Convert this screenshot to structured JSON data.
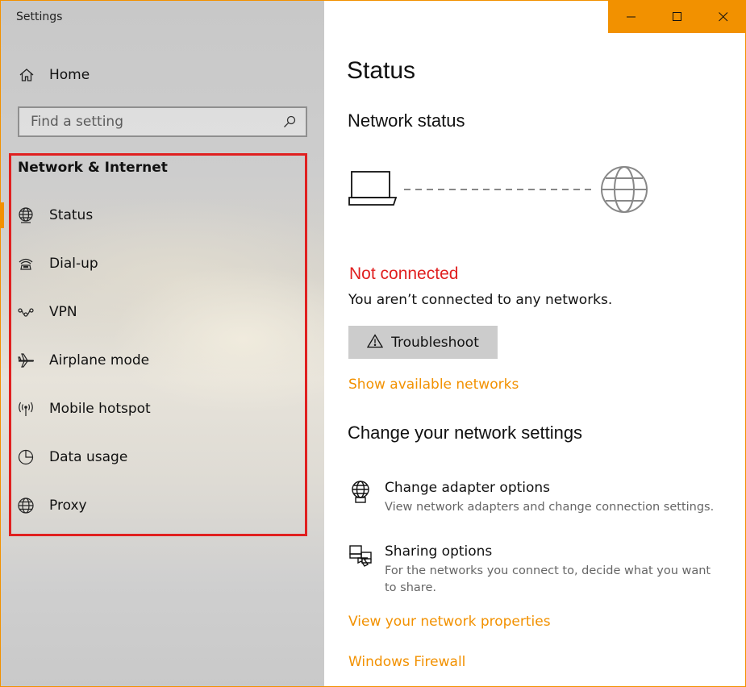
{
  "window": {
    "title": "Settings",
    "accent_color": "#f29100",
    "controls": [
      "minimize-icon",
      "maximize-icon",
      "close-icon"
    ]
  },
  "sidebar": {
    "home_label": "Home",
    "home_icon": "home-icon",
    "search_placeholder": "Find a setting",
    "search_icon": "search-icon",
    "section_title": "Network & Internet",
    "highlight_color": "#e02020",
    "items": [
      {
        "label": "Status",
        "icon": "status-globe-icon",
        "active": true
      },
      {
        "label": "Dial-up",
        "icon": "dial-up-icon"
      },
      {
        "label": "VPN",
        "icon": "vpn-icon"
      },
      {
        "label": "Airplane mode",
        "icon": "airplane-icon"
      },
      {
        "label": "Mobile hotspot",
        "icon": "hotspot-icon"
      },
      {
        "label": "Data usage",
        "icon": "data-usage-icon"
      },
      {
        "label": "Proxy",
        "icon": "proxy-globe-icon"
      }
    ]
  },
  "main": {
    "title": "Status",
    "network_status_title": "Network status",
    "status_text": "Not connected",
    "status_color": "#e02020",
    "status_desc": "You aren’t connected to any networks.",
    "troubleshoot_label": "Troubleshoot",
    "show_networks_link": "Show available networks",
    "change_heading": "Change your network settings",
    "options": [
      {
        "title": "Change adapter options",
        "desc": "View network adapters and change connection settings.",
        "icon": "adapter-icon"
      },
      {
        "title": "Sharing options",
        "desc": "For the networks you connect to, decide what you want to share.",
        "icon": "sharing-icon"
      }
    ],
    "view_properties_link": "View your network properties",
    "firewall_link": "Windows Firewall",
    "link_color": "#f29100"
  }
}
